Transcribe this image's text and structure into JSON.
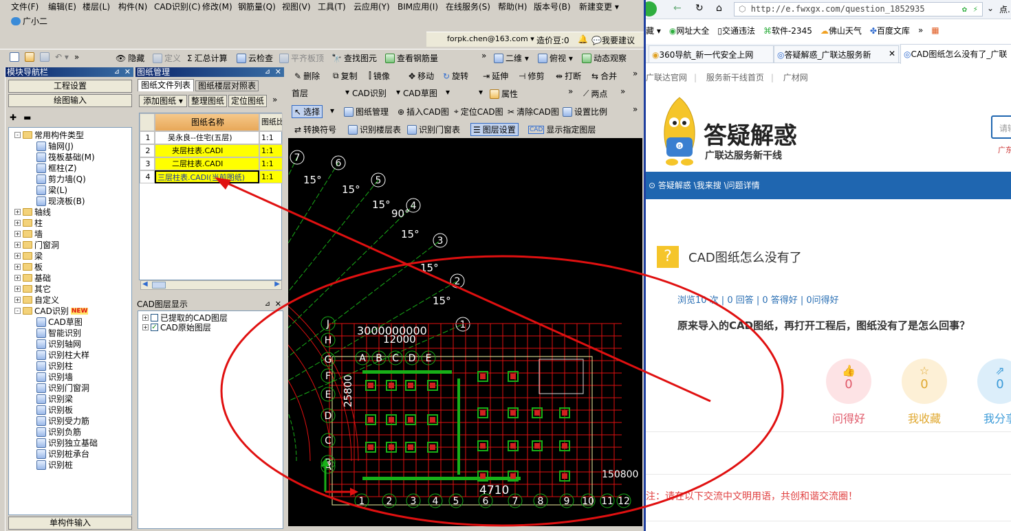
{
  "menu": [
    "文件(F)",
    "编辑(E)",
    "楼层(L)",
    "构件(N)",
    "CAD识别(C)",
    "修改(M)",
    "钢筋量(Q)",
    "视图(V)",
    "工具(T)",
    "云应用(Y)",
    "BIM应用(I)",
    "在线服务(S)",
    "帮助(H)",
    "版本号(B)",
    "新建变更 ▾"
  ],
  "assistant": "广小二",
  "account": {
    "email": "forpk.chen@163.com ▾",
    "beans": "造价豆:0",
    "suggest": "我要建议"
  },
  "toolbar1": {
    "hide": "隐藏",
    "define": "定义",
    "sum": "汇总计算",
    "cloud_check": "云检查",
    "flat_top": "平齐板顶",
    "find": "查找图元",
    "view_rebar": "查看钢筋量",
    "view2d": "二维 ▾",
    "top_view": "俯视 ▾",
    "dynamic": "动态观察"
  },
  "toolbar2": {
    "delete": "删除",
    "copy": "复制",
    "mirror": "镜像",
    "move": "移动",
    "rotate": "旋转",
    "extend": "延伸",
    "trim": "修剪",
    "break": "打断",
    "merge": "合并"
  },
  "toolbar3": {
    "floor": "首层",
    "cad_recog": "CAD识别",
    "cad_draft": "CAD草图",
    "props": "属性",
    "two_points": "两点"
  },
  "toolbar4": {
    "select": "选择",
    "drawing_mgr": "图纸管理",
    "insert_cad": "插入CAD图",
    "locate_cad": "定位CAD图",
    "clear_cad": "清除CAD图",
    "set_scale": "设置比例"
  },
  "toolbar5": {
    "convert": "转换符号",
    "recog_floor": "识别楼层表",
    "recog_door": "识别门窗表",
    "layer_set": "图层设置",
    "show_layer": "显示指定图层"
  },
  "module_nav": {
    "title": "模块导航栏",
    "project_settings": "工程设置",
    "draw_input": "绘图输入",
    "single_input": "单构件输入",
    "tree": [
      {
        "label": "常用构件类型",
        "level": 0,
        "exp": "-"
      },
      {
        "label": "轴网(J)",
        "level": 1
      },
      {
        "label": "筏板基础(M)",
        "level": 1
      },
      {
        "label": "框柱(Z)",
        "level": 1
      },
      {
        "label": "剪力墙(Q)",
        "level": 1
      },
      {
        "label": "梁(L)",
        "level": 1
      },
      {
        "label": "现浇板(B)",
        "level": 1
      },
      {
        "label": "轴线",
        "level": 0,
        "exp": "+"
      },
      {
        "label": "柱",
        "level": 0,
        "exp": "+"
      },
      {
        "label": "墙",
        "level": 0,
        "exp": "+"
      },
      {
        "label": "门窗洞",
        "level": 0,
        "exp": "+"
      },
      {
        "label": "梁",
        "level": 0,
        "exp": "+"
      },
      {
        "label": "板",
        "level": 0,
        "exp": "+"
      },
      {
        "label": "基础",
        "level": 0,
        "exp": "+"
      },
      {
        "label": "其它",
        "level": 0,
        "exp": "+"
      },
      {
        "label": "自定义",
        "level": 0,
        "exp": "+"
      },
      {
        "label": "CAD识别",
        "level": 0,
        "exp": "-",
        "badge": "NEW"
      },
      {
        "label": "CAD草图",
        "level": 1
      },
      {
        "label": "智能识别",
        "level": 1
      },
      {
        "label": "识别轴网",
        "level": 1
      },
      {
        "label": "识别柱大样",
        "level": 1
      },
      {
        "label": "识别柱",
        "level": 1
      },
      {
        "label": "识别墙",
        "level": 1
      },
      {
        "label": "识别门窗洞",
        "level": 1
      },
      {
        "label": "识别梁",
        "level": 1
      },
      {
        "label": "识别板",
        "level": 1
      },
      {
        "label": "识别受力筋",
        "level": 1
      },
      {
        "label": "识别负筋",
        "level": 1
      },
      {
        "label": "识别独立基础",
        "level": 1
      },
      {
        "label": "识别桩承台",
        "level": 1
      },
      {
        "label": "识别桩",
        "level": 1
      }
    ]
  },
  "drawing_mgr": {
    "title": "图纸管理",
    "tab1": "图纸文件列表",
    "tab2": "图纸楼层对照表",
    "add": "添加图纸",
    "organize": "整理图纸",
    "locate": "定位图纸",
    "col_name": "图纸名称",
    "col_ratio": "图纸比",
    "rows": [
      {
        "n": "1",
        "name": "吴永良--住宅(五层)",
        "ratio": "1:1"
      },
      {
        "n": "2",
        "name": "夹层柱表.CADI",
        "ratio": "1:1"
      },
      {
        "n": "3",
        "name": "二层柱表.CADI",
        "ratio": "1:1"
      },
      {
        "n": "4",
        "name": "三层柱表.CADI(当前图纸)",
        "ratio": "1:1"
      }
    ]
  },
  "layer_panel": {
    "title": "CAD图层显示",
    "item1": "已提取的CAD图层",
    "item2": "CAD原始图层"
  },
  "cad": {
    "angles": [
      "15°",
      "15°",
      "15°",
      "90°",
      "15°",
      "15°",
      "15°"
    ],
    "axis_top": [
      "7",
      "6",
      "5",
      "4",
      "3",
      "2",
      "1"
    ],
    "letters": [
      "J",
      "H",
      "G",
      "F",
      "E",
      "D",
      "C",
      "B",
      "A"
    ],
    "cols": [
      "A",
      "B",
      "C",
      "D",
      "E"
    ],
    "bottom": [
      "1",
      "2",
      "3",
      "4",
      "5",
      "6",
      "7",
      "8",
      "9",
      "10",
      "11",
      "12"
    ],
    "dim_top": "3000000000",
    "dim_12000": "12000",
    "dim_25800": "25800",
    "dim_4710": "4710",
    "dim_150": "150800"
  },
  "browser": {
    "url": "http://e.fwxgx.com/question_1852935",
    "ext": "点.",
    "favs": [
      "藏 ▾",
      "网址大全",
      "交通违法",
      "软件-2345",
      "佛山天气",
      "百度文库",
      "»"
    ],
    "tabs": [
      "360导航_新一代安全上网",
      "答疑解惑_广联达服务新",
      "CAD图纸怎么没有了_广联"
    ],
    "site_nav": [
      "广联达官网",
      "服务新干线首页",
      "广材网"
    ],
    "logo_title": "答疑解惑",
    "logo_sub": "广联达服务新干线",
    "search_ph": "请输",
    "region": "广东",
    "crumb": "答疑解惑 \\我来搜 \\问题详情",
    "q_title": "CAD图纸怎么没有了",
    "stats": "浏览10 次 | 0 回答 | 0 答得好 | 0问得好",
    "q_body": "原来导入的CAD图纸，再打开工程后，图纸没有了是怎么回事？",
    "actions": [
      {
        "count": "0",
        "label": "问得好"
      },
      {
        "count": "0",
        "label": "我收藏"
      },
      {
        "count": "0",
        "label": "我分享"
      }
    ],
    "notice": "注：请在以下交流中文明用语，共创和谐交流圈！"
  },
  "colors": {
    "title_bar": "#0a246a",
    "cad_bg": "#000000",
    "annot": "#e01010",
    "blue_bar": "#1f66b0"
  }
}
